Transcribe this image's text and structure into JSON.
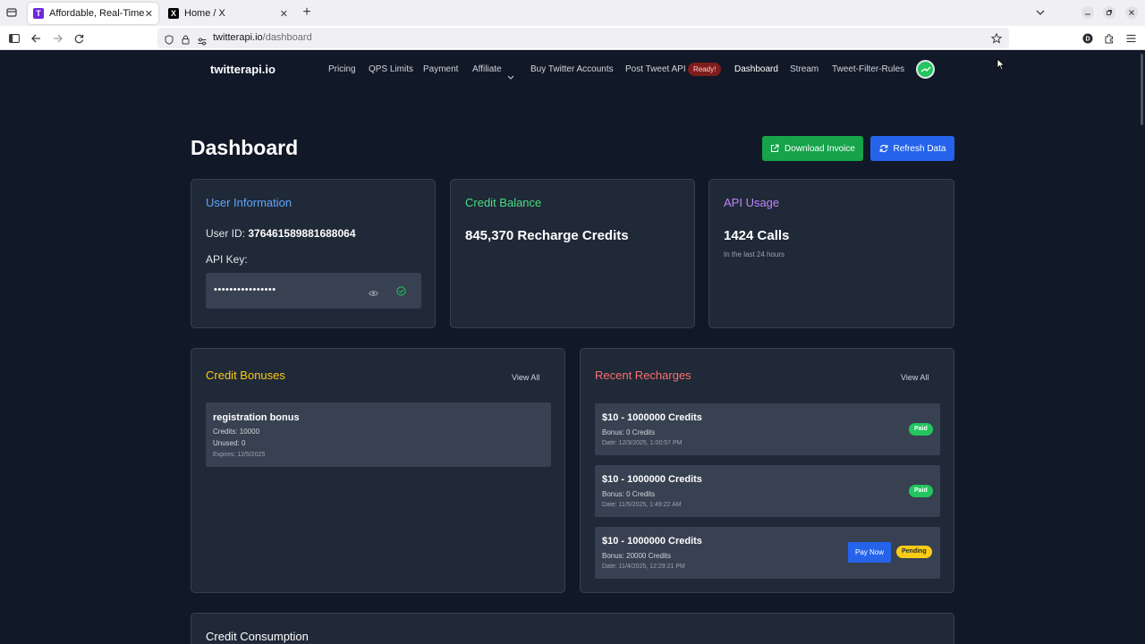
{
  "browser": {
    "tabs": [
      {
        "title": "Affordable, Real-Time X (",
        "favicon": "T"
      },
      {
        "title": "Home / X",
        "favicon": "X"
      }
    ],
    "url_host": "twitterapi.io",
    "url_path": "/dashboard"
  },
  "site": {
    "logo": "twitterapi.io",
    "nav": {
      "pricing": "Pricing",
      "qps": "QPS Limits",
      "payment": "Payment",
      "affiliate": "Affiliate",
      "buy": "Buy Twitter Accounts",
      "post": "Post Tweet API",
      "ready": "Ready!",
      "dashboard": "Dashboard",
      "stream": "Stream",
      "rules": "Tweet-Filter-Rules"
    }
  },
  "page": {
    "title": "Dashboard",
    "download_invoice": "Download Invoice",
    "refresh_data": "Refresh Data"
  },
  "user_info": {
    "title": "User Information",
    "user_id_label": "User ID:",
    "user_id": "376461589881688064",
    "api_key_label": "API Key:",
    "api_key_masked": "••••••••••••••••"
  },
  "credit_balance": {
    "title": "Credit Balance",
    "value": "845,370 Recharge Credits"
  },
  "api_usage": {
    "title": "API Usage",
    "value": "1424 Calls",
    "note": "In the last 24 hours"
  },
  "credit_bonuses": {
    "title": "Credit Bonuses",
    "view_all": "View All",
    "items": [
      {
        "name": "registration bonus",
        "credits": "Credits: 10000",
        "unused": "Unused: 0",
        "expires": "Expires: 12/5/2025"
      }
    ]
  },
  "recent_recharges": {
    "title": "Recent Recharges",
    "view_all": "View All",
    "pay_now": "Pay Now",
    "items": [
      {
        "title": "$10 - 1000000 Credits",
        "bonus": "Bonus: 0 Credits",
        "date": "Date: 12/3/2025, 1:00:57 PM",
        "status": "Paid"
      },
      {
        "title": "$10 - 1000000 Credits",
        "bonus": "Bonus: 0 Credits",
        "date": "Date: 11/5/2025, 1:49:22 AM",
        "status": "Paid"
      },
      {
        "title": "$10 - 1000000 Credits",
        "bonus": "Bonus: 20000 Credits",
        "date": "Date: 11/4/2025, 12:29:21 PM",
        "status": "Pending"
      }
    ]
  },
  "credit_consumption": {
    "title": "Credit Consumption"
  }
}
